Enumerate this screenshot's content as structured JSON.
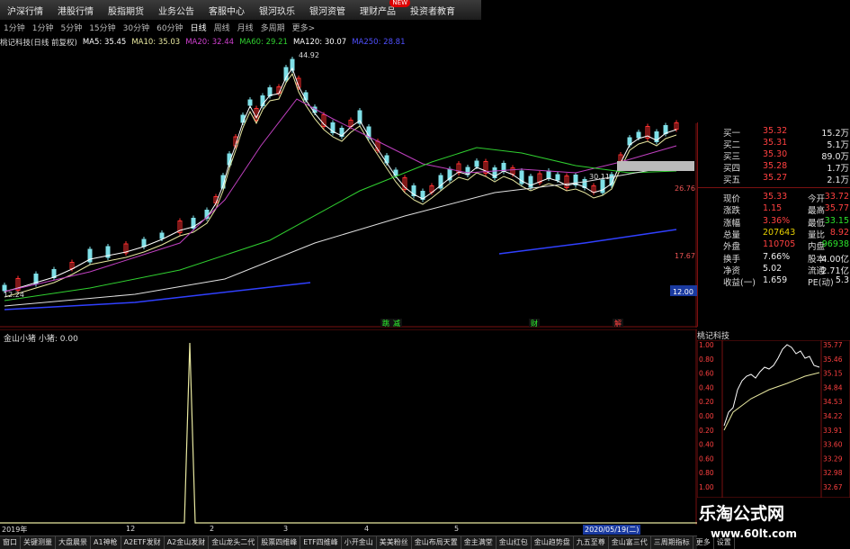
{
  "nav": [
    {
      "label": "沪深行情"
    },
    {
      "label": "港股行情"
    },
    {
      "label": "股指期货"
    },
    {
      "label": "业务公告"
    },
    {
      "label": "客服中心"
    },
    {
      "label": "银河玖乐"
    },
    {
      "label": "银河资管"
    },
    {
      "label": "理财产品",
      "badge": "NEW"
    },
    {
      "label": "投资者教育"
    }
  ],
  "periods": [
    "1分钟",
    "1分钟",
    "5分钟",
    "15分钟",
    "30分钟",
    "60分钟",
    "日线",
    "周线",
    "月线",
    "多周期",
    "更多>"
  ],
  "active_period": "日线",
  "stock_header": "桃记科技(日线 前复权)",
  "ma_legend": [
    {
      "label": "MA5: 35.45",
      "color": "#ffffff"
    },
    {
      "label": "MA10: 35.03",
      "color": "#e8e8a0"
    },
    {
      "label": "MA20: 32.44",
      "color": "#d040d0"
    },
    {
      "label": "MA60: 29.21",
      "color": "#30d030"
    },
    {
      "label": "MA120: 30.07",
      "color": "#ffffff"
    },
    {
      "label": "MA250: 28.81",
      "color": "#5050ff"
    }
  ],
  "chart_annotations": {
    "high": "44.92",
    "low": "12.24",
    "mid": "26.76",
    "mid2": "17.67",
    "cross": "30.11"
  },
  "price_ticks": [
    "12.00"
  ],
  "signal_labels": [
    "跳",
    "减",
    "财",
    "解"
  ],
  "quote": {
    "bids": [
      {
        "label": "买一",
        "price": "35.32",
        "vol": "15.2万"
      },
      {
        "label": "买二",
        "price": "35.31",
        "vol": "5.1万"
      },
      {
        "label": "买三",
        "price": "35.30",
        "vol": "89.0万"
      },
      {
        "label": "买四",
        "price": "35.28",
        "vol": "1.7万"
      },
      {
        "label": "买五",
        "price": "35.27",
        "vol": "2.1万"
      }
    ],
    "stats": [
      {
        "k": "现价",
        "v": "35.33",
        "k2": "今开",
        "v2": "33.72"
      },
      {
        "k": "涨跌",
        "v": "1.15",
        "k2": "最高",
        "v2": "35.77"
      },
      {
        "k": "涨幅",
        "v": "3.36%",
        "k2": "最低",
        "v2": "33.15"
      },
      {
        "k": "总量",
        "v": "207643",
        "k2": "量比",
        "v2": "8.92"
      },
      {
        "k": "外盘",
        "v": "110705",
        "k2": "内盘",
        "v2": "96938"
      },
      {
        "k": "换手",
        "v": "7.66%",
        "k2": "股本",
        "v2": "4.00亿"
      },
      {
        "k": "净资",
        "v": "5.02",
        "k2": "流通",
        "v2": "2.71亿"
      },
      {
        "k": "收益(一)",
        "v": "1.659",
        "k2": "PE(动)",
        "v2": "5.3"
      }
    ]
  },
  "mini": {
    "title": "桃记科技",
    "left_ticks": [
      "1.00",
      "0.80",
      "0.60",
      "0.40",
      "0.20",
      "0.00",
      "0.20",
      "0.40",
      "0.60",
      "0.80",
      "1.00"
    ],
    "right_ticks": [
      "35.77",
      "35.46",
      "35.15",
      "34.84",
      "34.53",
      "34.22",
      "33.91",
      "33.60",
      "33.29",
      "32.98",
      "32.67"
    ]
  },
  "indicator": {
    "label": "金山小猪 小猪: 0.00"
  },
  "dates": [
    "2019年",
    "12",
    "2",
    "3",
    "4",
    "5",
    "2020/05/19(二)"
  ],
  "tabs": [
    "窗口",
    "关键测量",
    "大盘晨景",
    "A1神枪",
    "A2ETF发财",
    "A2金山发财",
    "金山龙头二代",
    "股票四维峰",
    "ETF四维峰",
    "小开金山",
    "美美粉丝",
    "金山布局天置",
    "金主满堂",
    "金山红包",
    "金山趋势盘",
    "九五至尊",
    "金山富三代",
    "三周期指标",
    "更多",
    "设置"
  ],
  "watermark": {
    "cn": "乐淘公式网",
    "url": "www.60lt.com"
  }
}
